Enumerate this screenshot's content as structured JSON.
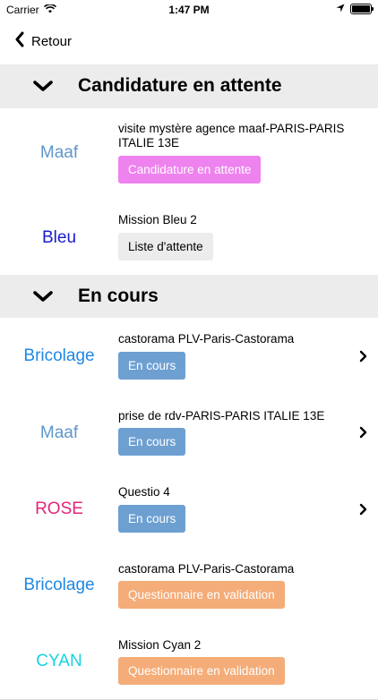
{
  "status_bar": {
    "carrier": "Carrier",
    "time": "1:47 PM"
  },
  "nav": {
    "back_label": "Retour"
  },
  "sections": [
    {
      "title": "Candidature en attente"
    },
    {
      "title": "En cours"
    }
  ],
  "rows": [
    {
      "brand": "Maaf",
      "brand_color": "#5f97c9",
      "title": "visite mystère agence maaf-PARIS-PARIS ITALIE 13E",
      "status": "Candidature en attente",
      "status_bg": "#ee82ee",
      "status_fg": "#ffffff",
      "has_chevron": false
    },
    {
      "brand": "Bleu",
      "brand_color": "#1a1acc",
      "title": "Mission Bleu 2",
      "status": "Liste d'attente",
      "status_bg": "#ececec",
      "status_fg": "#000000",
      "has_chevron": false
    },
    {
      "brand": "Bricolage",
      "brand_color": "#1e88e5",
      "title": "castorama PLV-Paris-Castorama",
      "status": "En cours",
      "status_bg": "#6e9fd1",
      "status_fg": "#ffffff",
      "has_chevron": true
    },
    {
      "brand": "Maaf",
      "brand_color": "#5f97c9",
      "title": "prise de rdv-PARIS-PARIS ITALIE 13E",
      "status": "En cours",
      "status_bg": "#6e9fd1",
      "status_fg": "#ffffff",
      "has_chevron": true
    },
    {
      "brand": "ROSE",
      "brand_color": "#e3257a",
      "title": "Questio 4",
      "status": "En cours",
      "status_bg": "#6e9fd1",
      "status_fg": "#ffffff",
      "has_chevron": true
    },
    {
      "brand": "Bricolage",
      "brand_color": "#1e88e5",
      "title": "castorama PLV-Paris-Castorama",
      "status": "Questionnaire en validation",
      "status_bg": "#f4ac78",
      "status_fg": "#ffffff",
      "has_chevron": false
    },
    {
      "brand": "CYAN",
      "brand_color": "#17d2e0",
      "title": "Mission Cyan 2",
      "status": "Questionnaire en validation",
      "status_bg": "#f4ac78",
      "status_fg": "#ffffff",
      "has_chevron": false
    }
  ]
}
